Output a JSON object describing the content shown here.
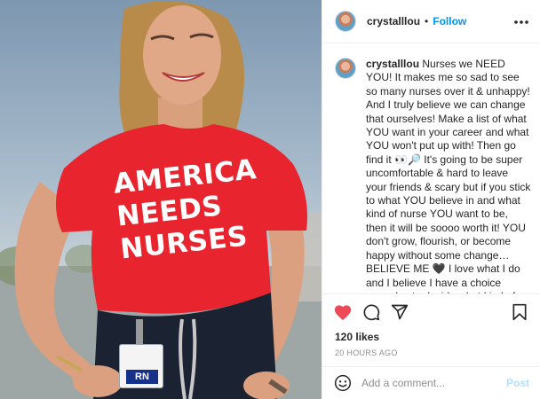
{
  "post": {
    "author": {
      "username": "crystalllou",
      "follow_label": "Follow",
      "separator": "•"
    },
    "more_icon": "more-horizontal-icon",
    "image": {
      "shirt_lines": [
        "AMERICA",
        "NEEDS",
        "NURSES"
      ],
      "badge_text": "RN"
    },
    "caption": {
      "username": "crystalllou",
      "text": "Nurses we NEED YOU! It makes me so sad to see so many nurses over it & unhappy! And I truly believe we can change that ourselves! Make a list of what YOU want in your career and what YOU won't put up with! Then go find it 👀🔎 It's going to be super uncomfortable & hard to leave your friends & scary but if you stick to what YOU believe in and what kind of nurse YOU want to be, then it will be soooo worth it! YOU don't grow, flourish, or become happy without some change…BELIEVE ME 🖤 I love what I do and I believe I have a choice everyday to decide what kind of nurse I want to be and how my career is going to go! Nobody is going to take that from me & YOU shouldn't let anyone"
    },
    "actions": {
      "like_icon": "heart-filled-icon",
      "comment_icon": "comment-icon",
      "share_icon": "share-icon",
      "save_icon": "bookmark-icon",
      "like_color": "#ed4956"
    },
    "likes_label": "120 likes",
    "timestamp": "20 HOURS AGO",
    "comment_box": {
      "emoji_icon": "smiley-icon",
      "placeholder": "Add a comment...",
      "post_label": "Post"
    }
  },
  "colors": {
    "link_blue": "#0095f6",
    "post_disabled": "#b2dffc",
    "shirt_red": "#e8242f",
    "muted_text": "#8e8e8e"
  }
}
